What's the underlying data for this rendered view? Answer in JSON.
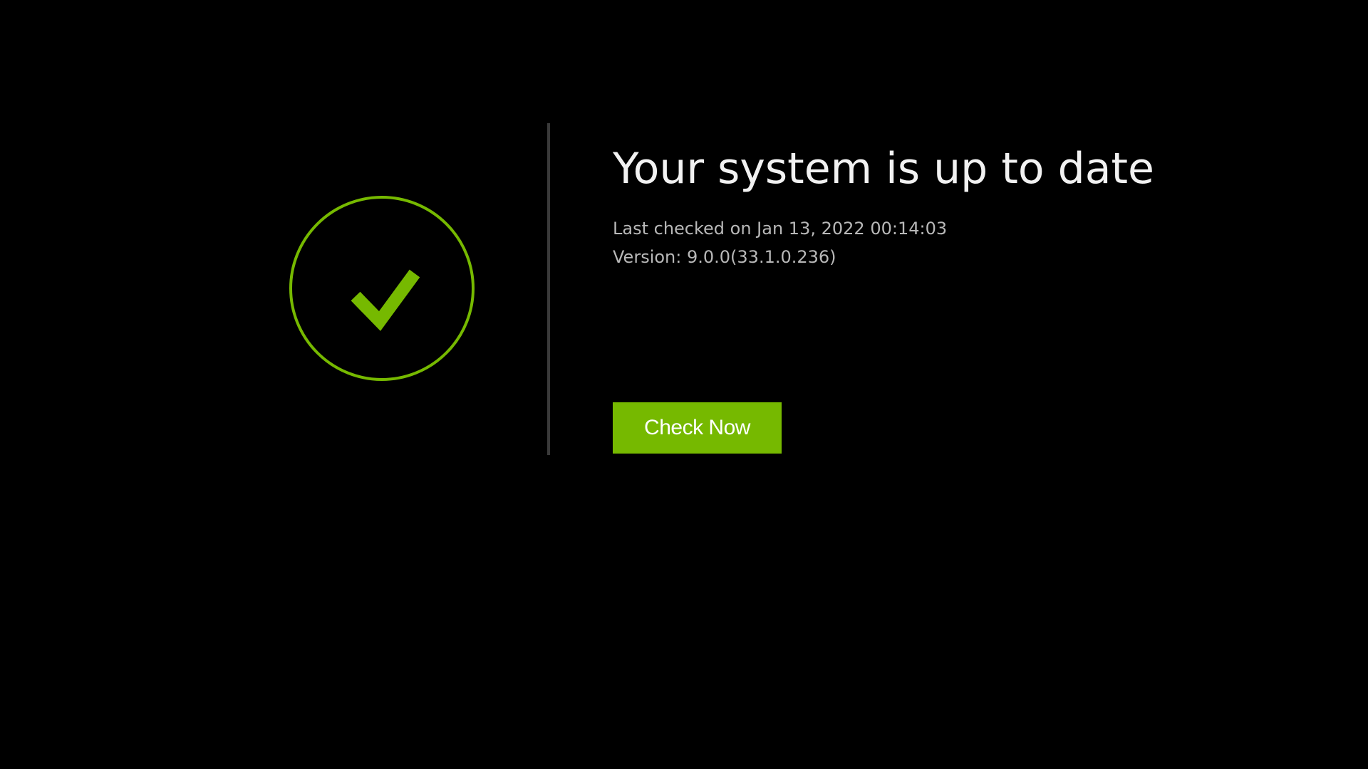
{
  "status": {
    "icon": "check-circle-icon",
    "title": "Your system is up to date",
    "last_checked": "Last checked on Jan 13, 2022 00:14:03",
    "version": "Version: 9.0.0(33.1.0.236)"
  },
  "actions": {
    "check_now_label": "Check Now"
  },
  "colors": {
    "accent": "#76b900",
    "background": "#000000",
    "title_text": "#f2f2f2",
    "secondary_text": "#b8b8b8",
    "divider": "#3a3a3a"
  }
}
